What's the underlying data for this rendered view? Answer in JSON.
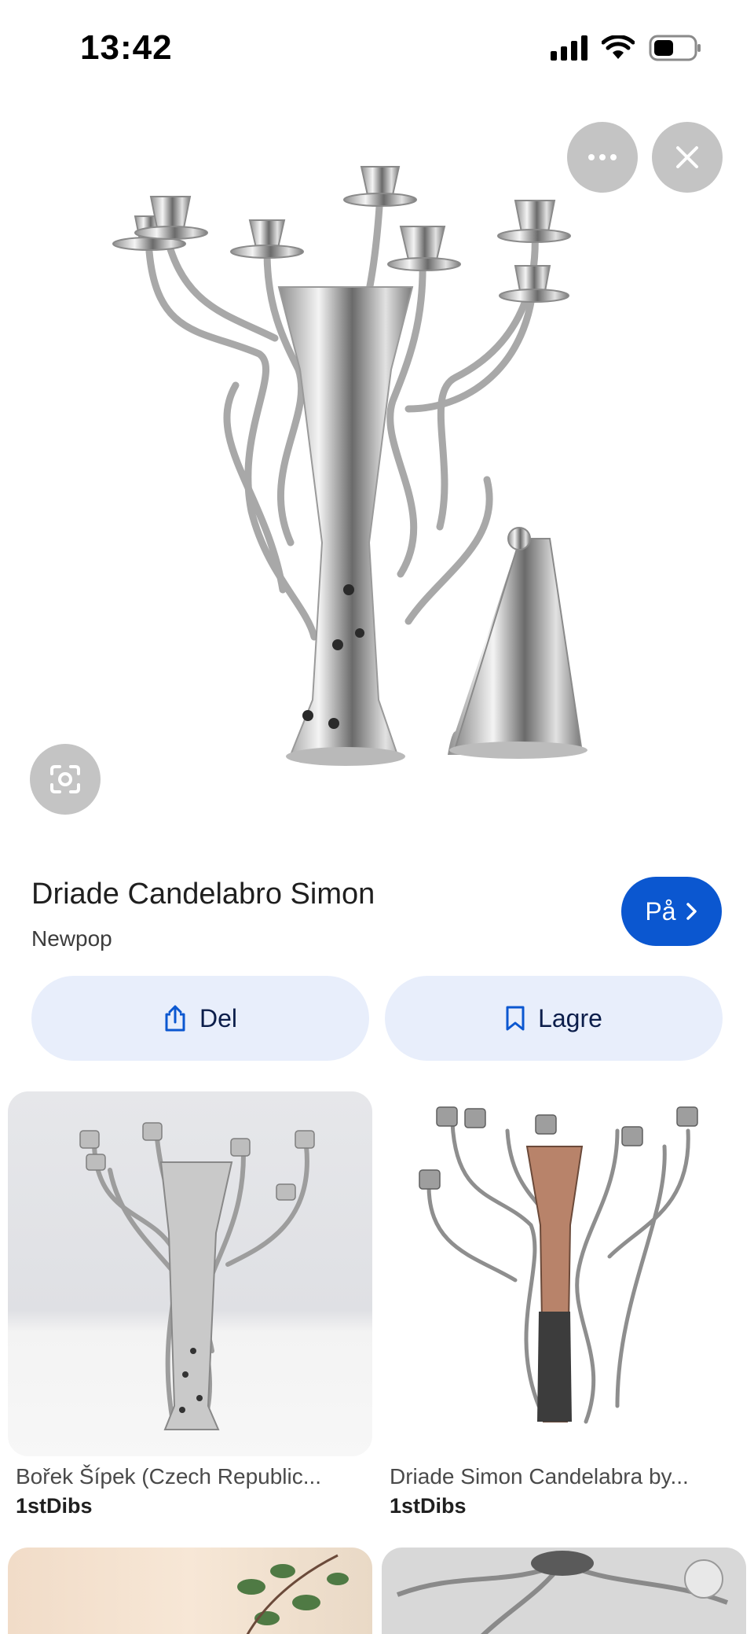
{
  "status_bar": {
    "time": "13:42"
  },
  "viewer": {
    "title": "Driade Candelabro Simon",
    "source": "Newpop",
    "visit_label": "På",
    "share_label": "Del",
    "save_label": "Lagre"
  },
  "results": [
    {
      "caption": "Bořek Šípek (Czech Republic...",
      "source": "1stDibs"
    },
    {
      "caption": "Driade Simon Candelabra by...",
      "source": "1stDibs"
    }
  ],
  "icons": {
    "more": "more-horizontal-icon",
    "close": "close-icon",
    "lens": "lens-icon",
    "share": "share-icon",
    "bookmark": "bookmark-icon",
    "chevron": "chevron-right-icon"
  },
  "colors": {
    "accent": "#0b57d0",
    "tonal_button": "#e8eefb",
    "overlay_button": "#c4c4c4"
  }
}
